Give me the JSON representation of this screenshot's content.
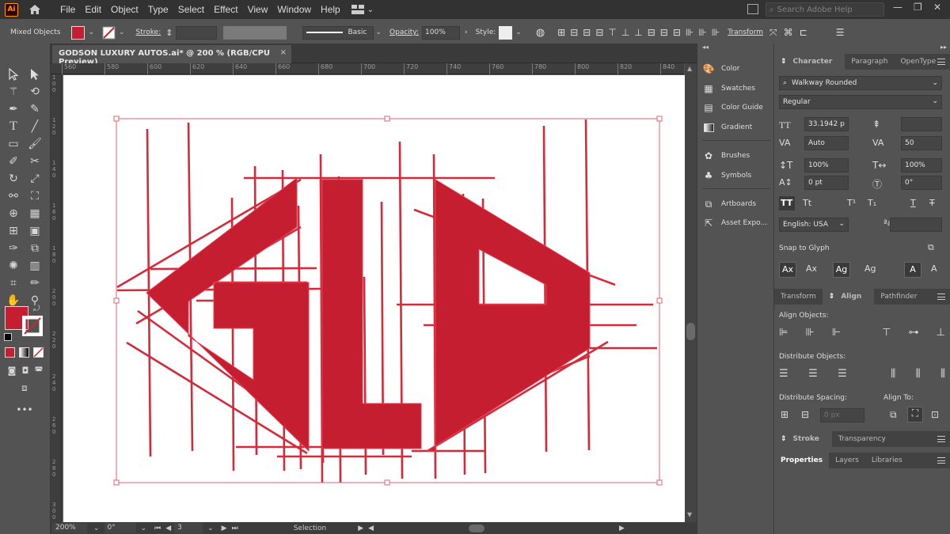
{
  "app": {
    "logo": "Ai",
    "menus": [
      "File",
      "Edit",
      "Object",
      "Type",
      "Select",
      "Effect",
      "View",
      "Window",
      "Help"
    ],
    "search_placeholder": "Search Adobe Help"
  },
  "control_bar": {
    "selection_label": "Mixed Objects",
    "fill_color": "#c41e30",
    "stroke_label": "Stroke:",
    "brush_label": "Basic",
    "opacity_label": "Opacity:",
    "opacity_value": "100%",
    "style_label": "Style:",
    "transform_label": "Transform"
  },
  "document": {
    "tab_title": "GODSON LUXURY AUTOS.ai* @ 200 % (RGB/CPU Preview)",
    "close_glyph": "×"
  },
  "ruler": {
    "h_ticks": [
      "560",
      "580",
      "600",
      "620",
      "640",
      "660",
      "680",
      "700",
      "720",
      "740",
      "760",
      "780",
      "800",
      "820",
      "840"
    ],
    "v_ticks": [
      "100",
      "120",
      "140",
      "160",
      "180",
      "200",
      "220",
      "240",
      "260",
      "280",
      "300"
    ]
  },
  "artwork": {
    "text": "GLA",
    "color": "#c41e30",
    "outline_color": "#e8404f"
  },
  "status_bar": {
    "zoom": "200%",
    "rotation": "0°",
    "artboard_number": "3",
    "tool_name": "Selection"
  },
  "dock": {
    "items": [
      "Color",
      "Swatches",
      "Color Guide",
      "Gradient",
      "Brushes",
      "Symbols",
      "Artboards",
      "Asset Expo..."
    ]
  },
  "character_panel": {
    "tabs": [
      "Character",
      "Paragraph",
      "OpenType"
    ],
    "font_family": "Walkway Rounded",
    "font_style": "Regular",
    "font_size": "33.1942 p",
    "leading": "",
    "kerning": "Auto",
    "tracking": "50",
    "vertical_scale": "100%",
    "horizontal_scale": "100%",
    "baseline_shift": "0 pt",
    "rotation": "0°",
    "language": "English: USA",
    "snap_to_glyph": "Snap to Glyph"
  },
  "align_panel": {
    "tabs": [
      "Transform",
      "Align",
      "Pathfinder"
    ],
    "align_objects_label": "Align Objects:",
    "distribute_objects_label": "Distribute Objects:",
    "distribute_spacing_label": "Distribute Spacing:",
    "align_to_label": "Align To:",
    "spacing_value": "0 px"
  },
  "stroke_panel": {
    "tabs": [
      "Stroke",
      "Transparency"
    ]
  },
  "bottom_tabs": [
    "Properties",
    "Layers",
    "Libraries"
  ]
}
